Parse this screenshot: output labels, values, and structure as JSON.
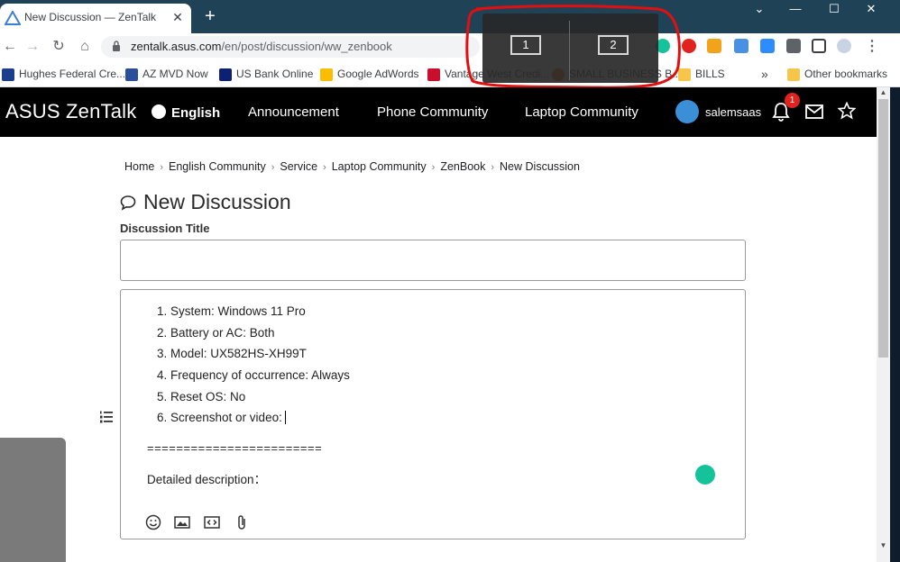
{
  "browser": {
    "tab_title": "New Discussion — ZenTalk",
    "close_glyph": "✕",
    "newtab_glyph": "+",
    "window_controls": [
      "⌄",
      "—",
      "☐",
      "✕"
    ],
    "url_domain": "zentalk.asus.com",
    "url_path": "/en/post/discussion/ww_zenbook",
    "nav_glyphs": {
      "back": "←",
      "forward": "→",
      "reload": "↻",
      "home": "⌂",
      "menu": "⋮"
    }
  },
  "bookmarks": [
    {
      "label": "Hughes Federal Cre...",
      "icon": "hughes-icon",
      "color": "#1a3e8c"
    },
    {
      "label": "AZ MVD Now",
      "icon": "azmvd-icon",
      "color": "#2a4d9c"
    },
    {
      "label": "US Bank Online",
      "icon": "usbank-icon",
      "color": "#0c2074"
    },
    {
      "label": "Google AdWords",
      "icon": "adwords-icon",
      "color": "#fbbc04"
    },
    {
      "label": "Vantage West Credi...",
      "icon": "vantage-icon",
      "color": "#c8102e"
    },
    {
      "label": "SMALL BUSINESS B...",
      "icon": "smb-icon",
      "color": "#e37400"
    },
    {
      "label": "BILLS",
      "icon": "folder-icon",
      "color": "#f6c64a"
    }
  ],
  "bookmarks_more": "»",
  "other_bookmarks": "Other bookmarks",
  "overlay": {
    "monitor_1": "1",
    "monitor_2": "2"
  },
  "site": {
    "logo": "ASUS ZenTalk",
    "language": "English",
    "nav": [
      "Announcement",
      "Phone Community",
      "Laptop Community"
    ],
    "username": "salemsaas",
    "notification_count": "1",
    "accent": "#e1231e"
  },
  "breadcrumb": [
    "Home",
    "English Community",
    "Service",
    "Laptop Community",
    "ZenBook",
    "New Discussion"
  ],
  "breadcrumb_sep": "›",
  "page_title": "New Discussion",
  "discussion_title_label": "Discussion Title",
  "editor": {
    "list": [
      "System: Windows 11 Pro",
      "Battery or AC: Both",
      "Model: UX582HS-XH99T",
      "Frequency of occurrence: Always",
      "Reset OS: No",
      "Screenshot or video:"
    ],
    "separator": "========================",
    "description_label": "Detailed description："
  }
}
